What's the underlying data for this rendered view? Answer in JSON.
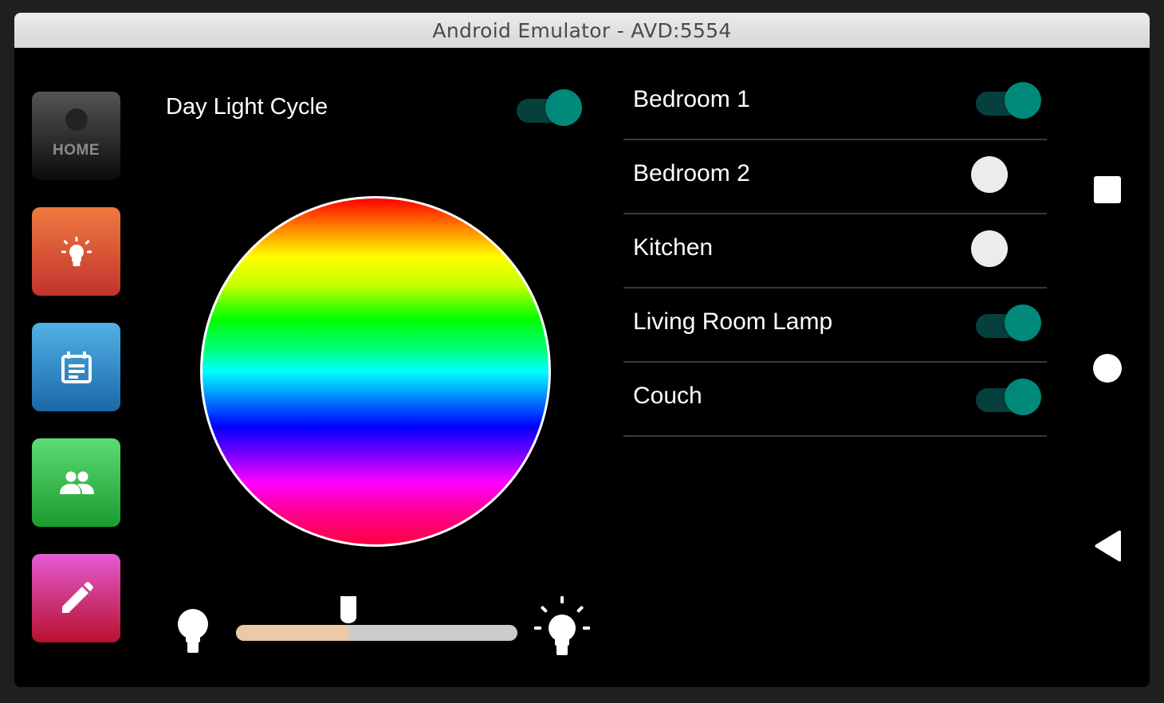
{
  "window": {
    "title": "Android Emulator - AVD:5554"
  },
  "nav": {
    "home_label": "HOME",
    "items": [
      "home-icon",
      "lightbulb-icon",
      "calendar-icon",
      "people-icon",
      "pencil-icon"
    ]
  },
  "day_light_cycle": {
    "label": "Day Light Cycle",
    "enabled": true
  },
  "color_wheel": {
    "style": "vertical-spectrum"
  },
  "brightness": {
    "value": 0.4,
    "min_icon": "dim-bulb-icon",
    "max_icon": "bright-bulb-icon"
  },
  "rooms": [
    {
      "name": "Bedroom 1",
      "on": true
    },
    {
      "name": "Bedroom 2",
      "on": false
    },
    {
      "name": "Kitchen",
      "on": false
    },
    {
      "name": "Living Room Lamp",
      "on": true
    },
    {
      "name": "Couch",
      "on": true
    }
  ],
  "android_nav": [
    "recents-icon",
    "home-circle-icon",
    "back-icon"
  ],
  "colors": {
    "switch_on": "#00897b",
    "switch_track": "#05403d",
    "slider_fill": "#ebc9a6"
  }
}
